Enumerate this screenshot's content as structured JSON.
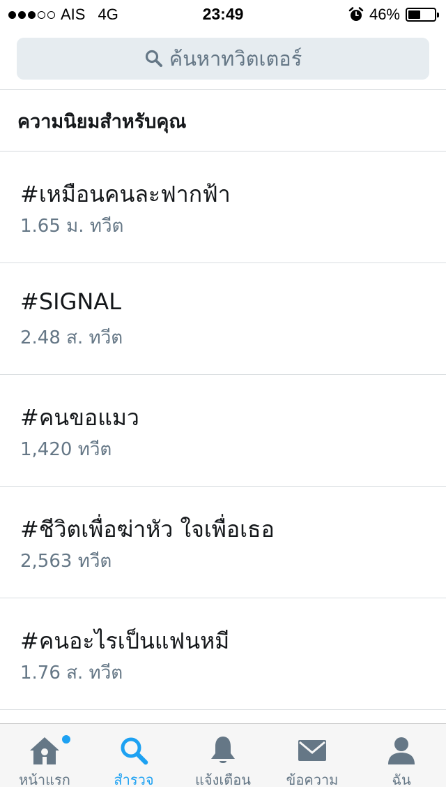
{
  "status_bar": {
    "carrier": "AIS",
    "network": "4G",
    "time": "23:49",
    "battery_text": "46%",
    "signal_bars_filled": 3,
    "signal_bars_total": 5,
    "battery_level": 0.46
  },
  "search": {
    "placeholder": "ค้นหาทวิตเตอร์"
  },
  "section": {
    "title": "ความนิยมสำหรับคุณ"
  },
  "trends": [
    {
      "name": "#เหมือนคนละฟากฟ้า",
      "count": "1.65 ม. ทวีต"
    },
    {
      "name": "#SIGNAL",
      "count": "2.48 ส. ทวีต"
    },
    {
      "name": "#คนขอแมว",
      "count": "1,420 ทวีต"
    },
    {
      "name": "#ชีวิตเพื่อฆ่าหัว ใจเพื่อเธอ",
      "count": "2,563 ทวีต"
    },
    {
      "name": "#คนอะไรเป็นแฟนหมี",
      "count": "1.76 ส. ทวีต"
    }
  ],
  "tabbar": {
    "tabs": [
      {
        "label": "หน้าแรก",
        "icon": "home-icon"
      },
      {
        "label": "สำรวจ",
        "icon": "search-icon",
        "active": true
      },
      {
        "label": "แจ้งเตือน",
        "icon": "bell-icon"
      },
      {
        "label": "ข้อความ",
        "icon": "envelope-icon"
      },
      {
        "label": "ฉัน",
        "icon": "person-icon"
      }
    ]
  },
  "colors": {
    "accent": "#1da1f2",
    "muted": "#657786",
    "search_bg": "#e6ecf0"
  }
}
